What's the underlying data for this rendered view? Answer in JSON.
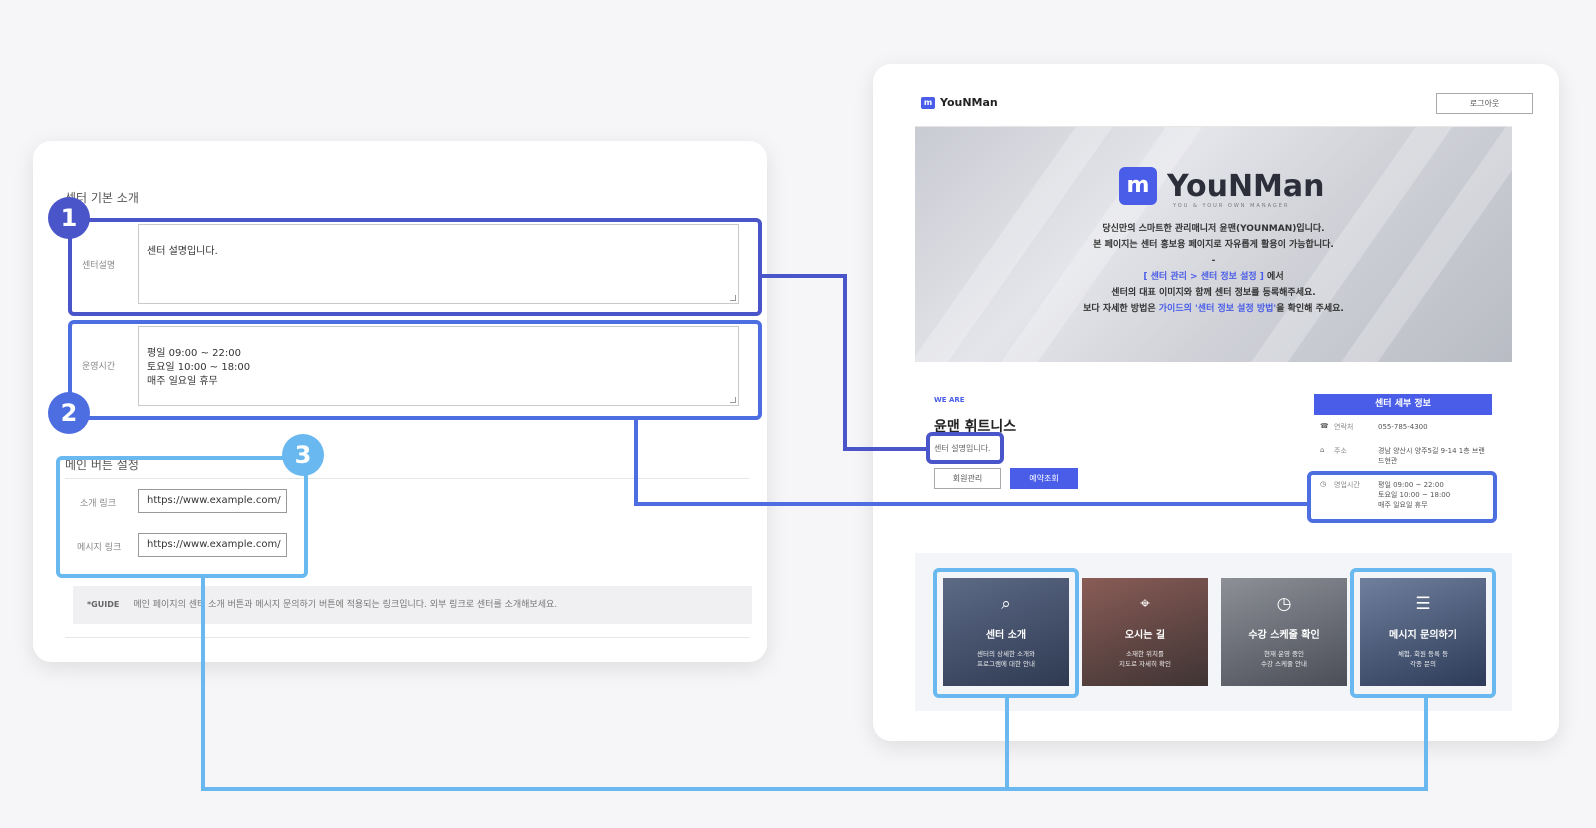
{
  "settings_panel": {
    "section_intro_title": "센터 기본 소개",
    "description_label": "센터설명",
    "description_value": "센터 설명입니다.",
    "hours_label": "운영시간",
    "hours_value": "평일 09:00 ~ 22:00\n토요일 10:00 ~ 18:00\n매주 일요일 휴무",
    "buttons_section_title": "메인 버튼 설정",
    "intro_link_label": "소개 링크",
    "intro_link_value": "https://www.example.com/",
    "message_link_label": "메시지 링크",
    "message_link_value": "https://www.example.com/",
    "guide_tag": "*GUIDE",
    "guide_text": "메인 페이지의 센터 소개 버튼과 메시지 문의하기 버튼에 적용되는 링크입니다. 외부 링크로 센터를 소개해보세요."
  },
  "badges": [
    "1",
    "2",
    "3"
  ],
  "preview": {
    "brand_name": "YouNMan",
    "logout_label": "로그아웃",
    "hero": {
      "logo_text": "YouNMan",
      "tagline": "YOU & YOUR OWN MANAGER",
      "line1": "당신만의 스마트한 관리매니저 윤맨(YOUNMAN)입니다.",
      "line2": "본 페이지는 센터 홍보용 페이지로 자유롭게 활용이 가능합니다.",
      "line3": "-",
      "line4_link": "[ 센터 관리 > 센터 정보 설정 ]",
      "line4_rest": " 에서",
      "line5": "센터의 대표 이미지와 함께 센터 정보를 등록해주세요.",
      "line6_pre": "보다 자세한 방법은 ",
      "line6_link": "가이드의 '센터 정보 설정 방법'",
      "line6_post": "을 확인해 주세요."
    },
    "we_are": "WE ARE",
    "center_name": "윤맨 휘트니스",
    "center_desc": "센터 설명입니다.",
    "member_button": "회원관리",
    "booking_button": "예약조회",
    "detail_title": "센터 세부 정보",
    "detail_rows": [
      {
        "icon": "☎",
        "key": "연락처",
        "value": "055-785-4300"
      },
      {
        "icon": "⌂",
        "key": "주소",
        "value": "경남 양산시 양주5길 9-14 1층 브랜드현관"
      },
      {
        "icon": "◷",
        "key": "영업시간",
        "value": "평일 09:00 ~ 22:00\n토요일 10:00 ~ 18:00\n매주 일요일 휴무"
      }
    ],
    "cards": [
      {
        "icon": "⌕",
        "title": "센터 소개",
        "desc": "센터의 상세한 소개와\n프로그램에 대한 안내"
      },
      {
        "icon": "⌖",
        "title": "오시는 길",
        "desc": "소재한 위치를\n지도로 자세히 확인"
      },
      {
        "icon": "◷",
        "title": "수강 스케줄 확인",
        "desc": "현재 운영 중인\n수강 스케줄 안내"
      },
      {
        "icon": "☰",
        "title": "메시지 문의하기",
        "desc": "체험, 회원 등록 등\n각종 문의"
      }
    ]
  },
  "colors": {
    "marker_1": "#4a55c9",
    "marker_2": "#4d6ee0",
    "marker_3": "#69b8f0",
    "brand_blue": "#4a5de8"
  }
}
